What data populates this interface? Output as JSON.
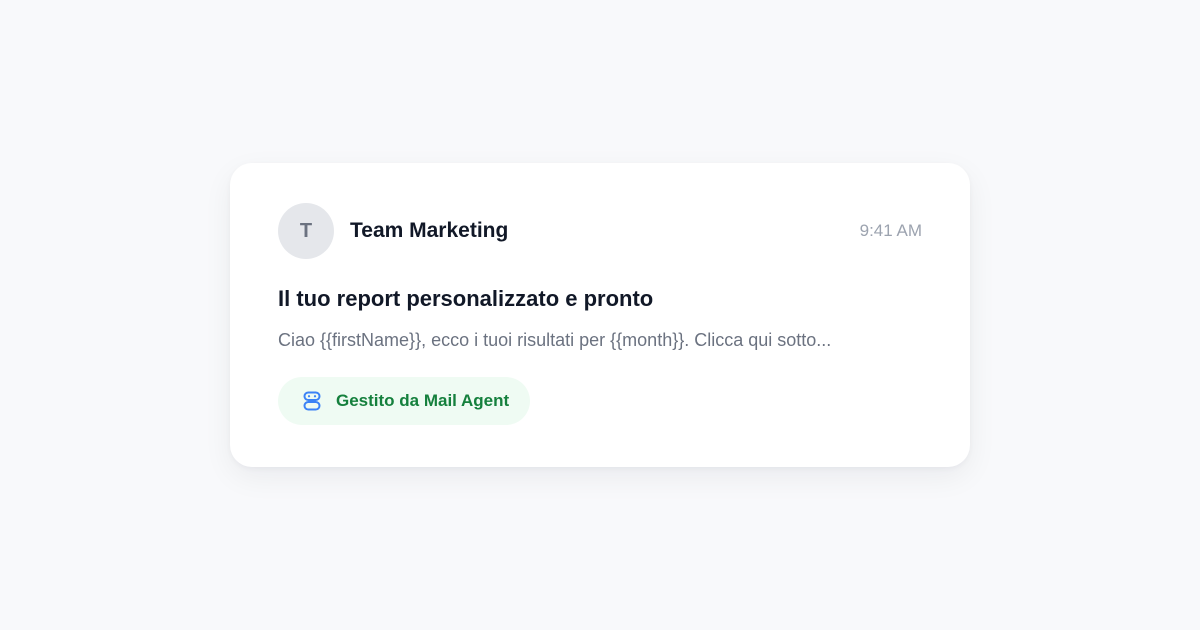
{
  "email": {
    "avatar_initial": "T",
    "sender": "Team Marketing",
    "time": "9:41 AM",
    "subject": "Il tuo report personalizzato e pronto",
    "preview": "Ciao {{firstName}}, ecco i tuoi risultati per {{month}}. Clicca qui sotto...",
    "badge": {
      "icon": "robot-icon",
      "label": "Gestito da Mail Agent"
    }
  },
  "colors": {
    "background": "#f8f9fb",
    "card": "#ffffff",
    "avatar_bg": "#e5e7eb",
    "badge_bg": "#effbf3",
    "badge_text": "#15803d",
    "badge_icon": "#3b82f6"
  }
}
